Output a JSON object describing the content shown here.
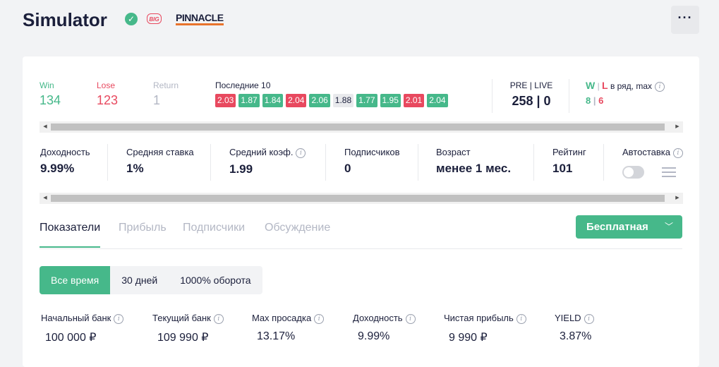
{
  "header": {
    "title": "Simulator",
    "badge_big": "BIG",
    "bookmaker": "PINNACLE",
    "more_label": "···"
  },
  "stats": {
    "win": {
      "label": "Win",
      "value": "134"
    },
    "lose": {
      "label": "Lose",
      "value": "123"
    },
    "return": {
      "label": "Return",
      "value": "1"
    },
    "last10_label": "Последние 10",
    "last10": [
      {
        "value": "2.03",
        "result": "lose"
      },
      {
        "value": "1.87",
        "result": "win"
      },
      {
        "value": "1.84",
        "result": "win"
      },
      {
        "value": "2.04",
        "result": "lose"
      },
      {
        "value": "2.06",
        "result": "win"
      },
      {
        "value": "1.88",
        "result": "return"
      },
      {
        "value": "1.77",
        "result": "win"
      },
      {
        "value": "1.95",
        "result": "win"
      },
      {
        "value": "2.01",
        "result": "lose"
      },
      {
        "value": "2.04",
        "result": "win"
      }
    ],
    "prelive": {
      "label": "PRE | LIVE",
      "pre": "258",
      "live": "0"
    },
    "streak": {
      "w": "W",
      "l": "L",
      "label_suffix": "в ряд, max",
      "w_value": "8",
      "l_value": "6"
    }
  },
  "metrics": {
    "yield": {
      "label": "Доходность",
      "value": "9.99%"
    },
    "avg_stake": {
      "label": "Средняя ставка",
      "value": "1%"
    },
    "avg_odds": {
      "label": "Средний коэф.",
      "value": "1.99"
    },
    "subscribers": {
      "label": "Подписчиков",
      "value": "0"
    },
    "age": {
      "label": "Возраст",
      "value": "менее 1 мес."
    },
    "rating": {
      "label": "Рейтинг",
      "value": "101"
    },
    "autobet": {
      "label": "Автоставка"
    }
  },
  "tabs": [
    "Показатели",
    "Прибыль",
    "Подписчики",
    "Обсуждение"
  ],
  "plan_button": "Бесплатная",
  "periods": [
    "Все время",
    "30 дней",
    "1000% оборота"
  ],
  "bank": {
    "start": {
      "label": "Начальный банк",
      "value": "100 000 ₽"
    },
    "current": {
      "label": "Текущий банк",
      "value": "109 990 ₽"
    },
    "max_drawdown": {
      "label": "Max просадка",
      "value": "13.17%"
    },
    "yield": {
      "label": "Доходность",
      "value": "9.99%"
    },
    "net_profit": {
      "label": "Чистая прибыль",
      "value": "9 990 ₽"
    },
    "yield_pct": {
      "label": "YIELD",
      "value": "3.87%"
    }
  },
  "colors": {
    "win": "#46b88a",
    "lose": "#e8495f",
    "return": "#e8e9ec",
    "accent": "#46b88a"
  }
}
